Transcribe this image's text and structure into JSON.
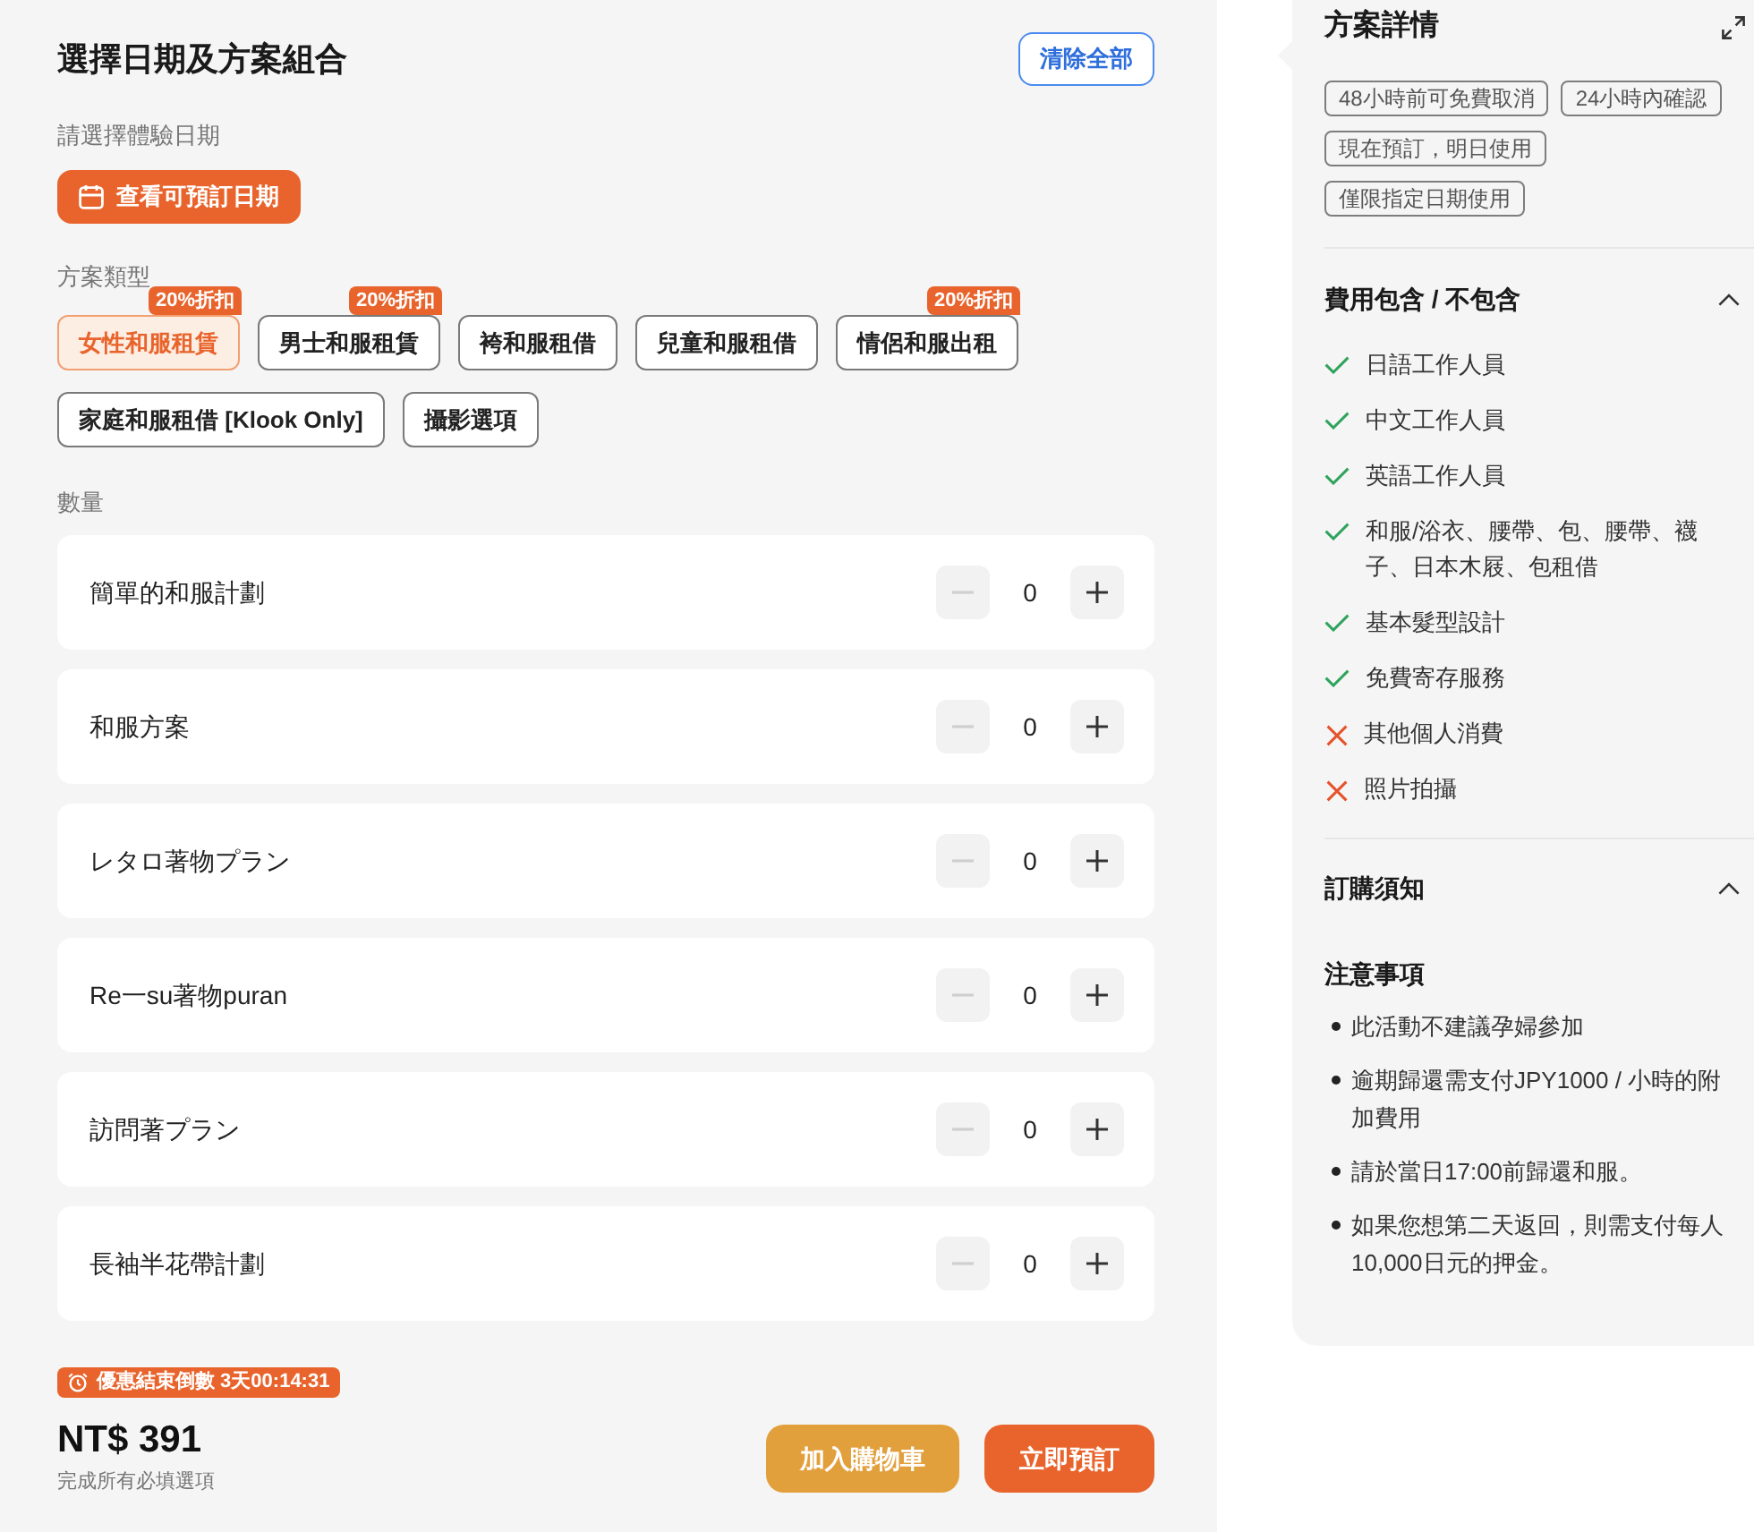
{
  "plan_selection": {
    "title": "選擇日期及方案組合",
    "clear_button": "清除全部",
    "date": {
      "label": "請選擇體驗日期",
      "button": "查看可預訂日期"
    },
    "plan_type": {
      "label": "方案類型",
      "options": [
        {
          "label": "女性和服租賃",
          "badge": "20%折扣",
          "selected": true
        },
        {
          "label": "男士和服租賃",
          "badge": "20%折扣",
          "selected": false
        },
        {
          "label": "袴和服租借",
          "selected": false
        },
        {
          "label": "兒童和服租借",
          "selected": false
        },
        {
          "label": "情侶和服出租",
          "badge": "20%折扣",
          "selected": false
        },
        {
          "label": "家庭和服租借 [Klook Only]",
          "selected": false
        },
        {
          "label": "攝影選項",
          "selected": false
        }
      ]
    },
    "quantity": {
      "label": "數量",
      "items": [
        {
          "name": "簡單的和服計劃",
          "count": "0",
          "minus_disabled": true
        },
        {
          "name": "和服方案",
          "count": "0",
          "minus_disabled": true
        },
        {
          "name": "レタロ著物プラン",
          "count": "0",
          "minus_disabled": true
        },
        {
          "name": "Re一su著物puran",
          "count": "0",
          "minus_disabled": true
        },
        {
          "name": "訪問著プラン",
          "count": "0",
          "minus_disabled": true
        },
        {
          "name": "長袖半花帶計劃",
          "count": "0",
          "minus_disabled": true
        }
      ]
    }
  },
  "footer": {
    "countdown": "優惠結束倒數 3天00:14:31",
    "price": "NT$ 391",
    "hint": "完成所有必填選項",
    "buttons": [
      {
        "label": "加入購物車",
        "kind": "cart"
      },
      {
        "label": "立即預訂",
        "kind": "book"
      }
    ]
  },
  "details": {
    "title": "方案詳情",
    "tags": [
      "48小時前可免費取消",
      "24小時內確認",
      "現在預訂，明日使用",
      "僅限指定日期使用"
    ],
    "inclusions": {
      "title": "費用包含 / 不包含",
      "expanded": true,
      "items": [
        {
          "text": "日語工作人員",
          "included": true
        },
        {
          "text": "中文工作人員",
          "included": true
        },
        {
          "text": "英語工作人員",
          "included": true
        },
        {
          "text": "和服/浴衣、腰帶、包、腰帶、襪子、日本木屐、包租借",
          "included": true
        },
        {
          "text": "基本髮型設計",
          "included": true
        },
        {
          "text": "免費寄存服務",
          "included": true
        },
        {
          "text": "其他個人消費",
          "included": false
        },
        {
          "text": "照片拍攝",
          "included": false
        }
      ]
    },
    "notice": {
      "title": "訂購須知",
      "expanded": true,
      "heading": "注意事項",
      "bullets": [
        "此活動不建議孕婦參加",
        "逾期歸還需支付JPY1000 / 小時的附加費用",
        "請於當日17:00前歸還和服。",
        "如果您想第二天返回，則需支付每人10,000日元的押金。"
      ]
    }
  }
}
